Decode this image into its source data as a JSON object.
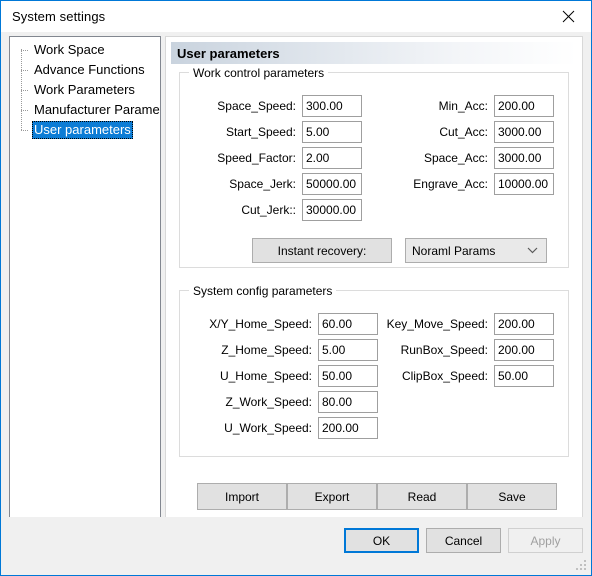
{
  "window": {
    "title": "System settings",
    "close_icon": "close-icon"
  },
  "tree": {
    "items": [
      {
        "label": "Work Space",
        "selected": false
      },
      {
        "label": "Advance Functions",
        "selected": false
      },
      {
        "label": "Work Parameters",
        "selected": false
      },
      {
        "label": "Manufacturer Paramet",
        "selected": false
      },
      {
        "label": "User parameters",
        "selected": true
      }
    ],
    "scrollbar": {
      "left_arrow": "❮",
      "right_arrow": "❯"
    }
  },
  "panel": {
    "header": "User parameters"
  },
  "work_control": {
    "legend": "Work control parameters",
    "left_fields": [
      {
        "label": "Space_Speed:",
        "value": "300.00"
      },
      {
        "label": "Start_Speed:",
        "value": "5.00"
      },
      {
        "label": "Speed_Factor:",
        "value": "2.00"
      },
      {
        "label": "Space_Jerk:",
        "value": "50000.00"
      },
      {
        "label": "Cut_Jerk::",
        "value": "30000.00"
      }
    ],
    "right_fields": [
      {
        "label": "Min_Acc:",
        "value": "200.00"
      },
      {
        "label": "Cut_Acc:",
        "value": "3000.00"
      },
      {
        "label": "Space_Acc:",
        "value": "3000.00"
      },
      {
        "label": "Engrave_Acc:",
        "value": "10000.00"
      }
    ],
    "recovery_button": "Instant recovery:",
    "recovery_select": "Noraml Params",
    "recovery_select_arrow": "chevron-down-icon"
  },
  "system_config": {
    "legend": "System config parameters",
    "left_fields": [
      {
        "label": "X/Y_Home_Speed:",
        "value": "60.00"
      },
      {
        "label": "Z_Home_Speed:",
        "value": "5.00"
      },
      {
        "label": "U_Home_Speed:",
        "value": "50.00"
      },
      {
        "label": "Z_Work_Speed:",
        "value": "80.00"
      },
      {
        "label": "U_Work_Speed:",
        "value": "200.00"
      }
    ],
    "right_fields": [
      {
        "label": "Key_Move_Speed:",
        "value": "200.00"
      },
      {
        "label": "RunBox_Speed:",
        "value": "200.00"
      },
      {
        "label": "ClipBox_Speed:",
        "value": "50.00"
      }
    ]
  },
  "actions": {
    "import": "Import",
    "export": "Export",
    "read": "Read",
    "save": "Save"
  },
  "footer": {
    "ok": "OK",
    "cancel": "Cancel",
    "apply": "Apply"
  },
  "colors": {
    "accent": "#0078d7",
    "selection": "#0c7cd5",
    "window_bg": "#f0f0f0",
    "button_face": "#e1e1e1"
  }
}
